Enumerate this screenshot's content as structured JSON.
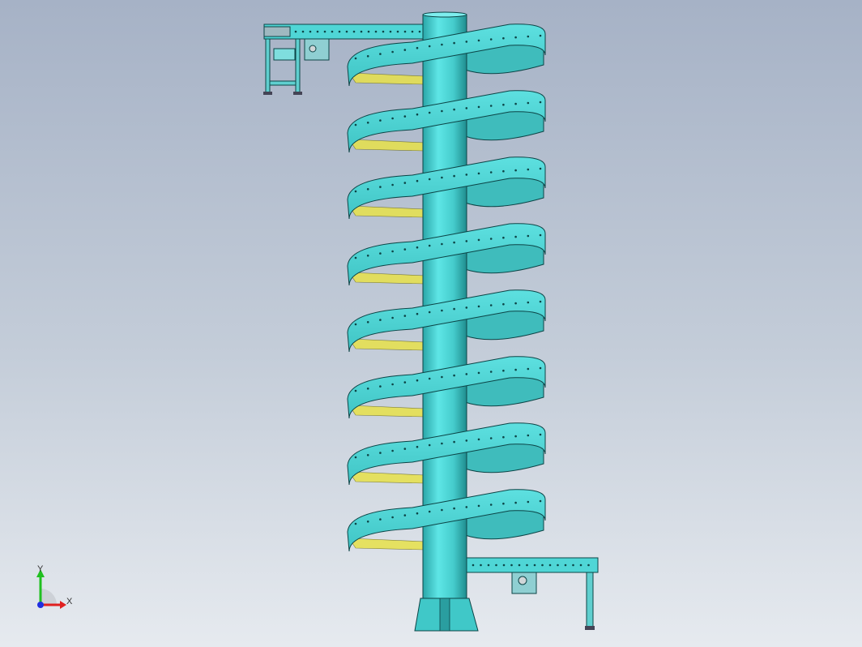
{
  "viewport": {
    "background_top": "#a6b2c6",
    "background_bottom": "#e6eaef"
  },
  "model": {
    "description": "spiral-conveyor",
    "colors": {
      "steel": "#4fd6d6",
      "steel_dark": "#2a9ea0",
      "steel_edge": "#0c4446",
      "roller_yellow": "#e8e24a",
      "frame": "#5fcfcf"
    },
    "turns": 8
  },
  "triad": {
    "x_label": "X",
    "y_label": "Y",
    "x_color": "#e02020",
    "y_color": "#20c020",
    "z_color": "#2030e0"
  }
}
